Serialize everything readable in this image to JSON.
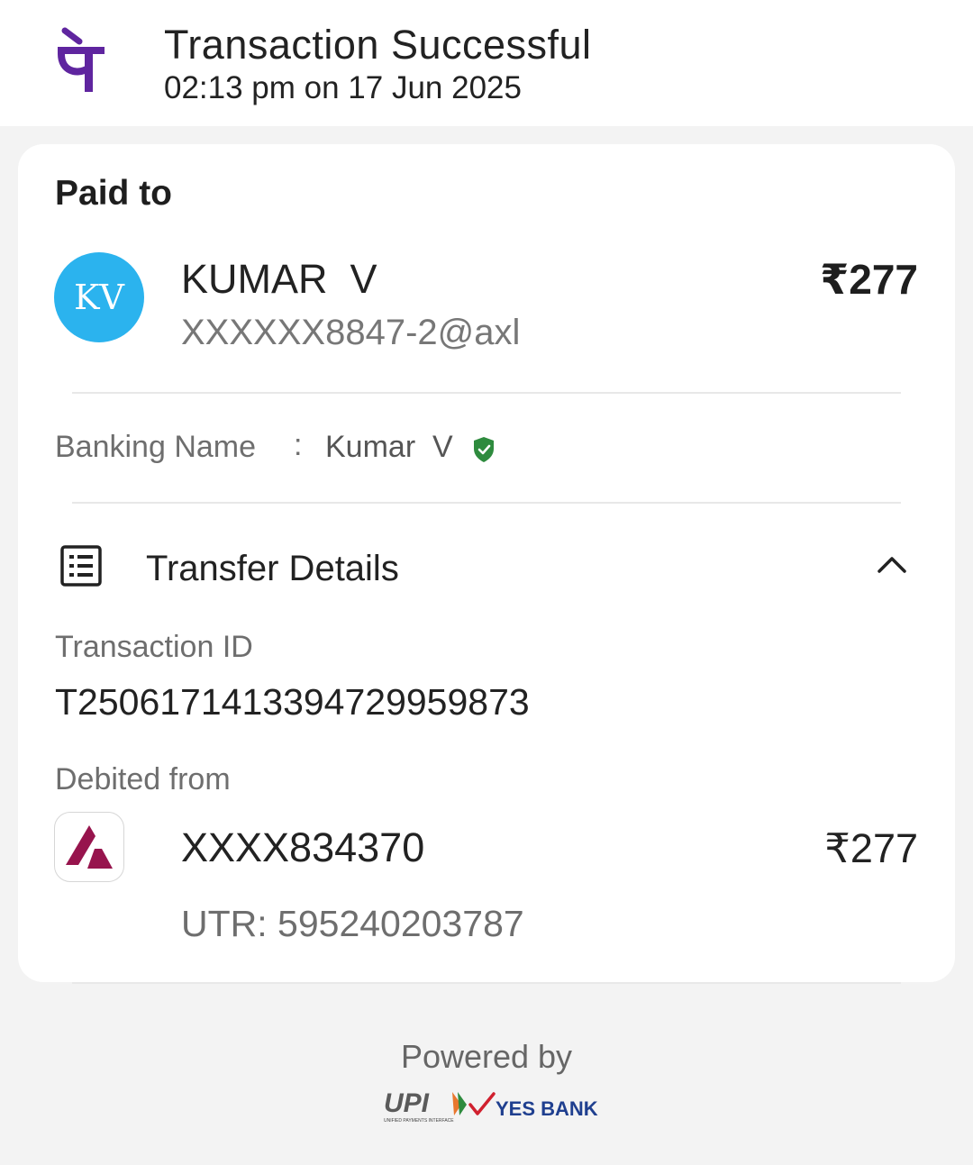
{
  "header": {
    "app_logo_glyph": "पे",
    "title": "Transaction Successful",
    "datetime": "02:13 pm on 17 Jun 2025"
  },
  "paid_to": {
    "section_label": "Paid to",
    "avatar_initials": "KV",
    "name": "KUMAR  V",
    "upi_id": "XXXXXX8847-2@axl",
    "amount": "₹277",
    "avatar_color": "#2bb3ee"
  },
  "banking": {
    "label": "Banking Name",
    "colon": ":",
    "value": "Kumar  V",
    "verified_icon": "verified-shield-icon",
    "verified_color": "#2e8b3e"
  },
  "transfer_details": {
    "title": "Transfer Details",
    "icon": "receipt-list-icon",
    "toggle_icon": "chevron-up-icon",
    "transaction_id_label": "Transaction ID",
    "transaction_id": "T2506171413394729959873",
    "debited_from_label": "Debited from",
    "account": "XXXX834370",
    "amount": "₹277",
    "utr": "UTR: 595240203787",
    "bank_logo_icon": "axis-bank-logo"
  },
  "footer": {
    "powered_by": "Powered by",
    "upi_logo_text": "UPI",
    "upi_tagline": "UNIFIED PAYMENTS INTERFACE",
    "bank_logo_text": "YES BANK"
  },
  "colors": {
    "brand_purple": "#5f259f",
    "axis_maroon": "#97144d"
  }
}
